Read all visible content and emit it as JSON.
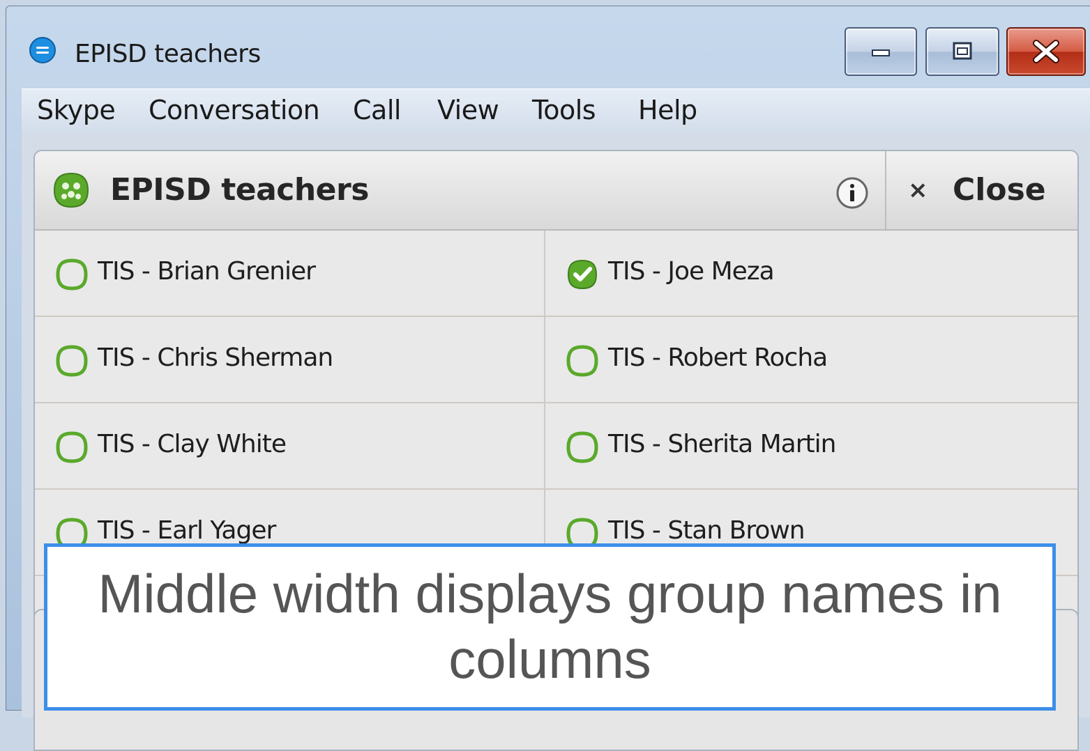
{
  "window": {
    "title": "EPISD teachers",
    "buttons": [
      "minimize",
      "maximize",
      "close"
    ]
  },
  "menu": [
    "Skype",
    "Conversation",
    "Call",
    "View",
    "Tools",
    "Help"
  ],
  "panel": {
    "title": "EPISD teachers",
    "info_icon": "info-icon",
    "close_label": "Close",
    "close_glyph": "×"
  },
  "contacts": {
    "left": [
      {
        "name": "TIS - Brian Grenier",
        "status": "offline"
      },
      {
        "name": "TIS - Chris Sherman",
        "status": "offline"
      },
      {
        "name": "TIS - Clay White",
        "status": "offline"
      },
      {
        "name": "TIS - Earl Yager",
        "status": "offline"
      }
    ],
    "right": [
      {
        "name": "TIS - Joe Meza",
        "status": "online"
      },
      {
        "name": "TIS - Robert Rocha",
        "status": "offline"
      },
      {
        "name": "TIS - Sherita Martin",
        "status": "offline"
      },
      {
        "name": "TIS - Stan Brown",
        "status": "offline"
      }
    ]
  },
  "caption": "Middle width displays group names in columns",
  "colors": {
    "status_green": "#5aa92b",
    "caption_border": "#3d8ee8",
    "close_button": "#c94a2f"
  }
}
